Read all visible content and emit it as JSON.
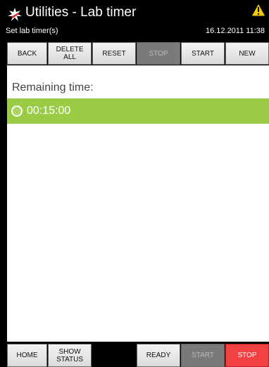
{
  "header": {
    "title": "Utilities - Lab timer",
    "subtitle": "Set lab timer(s)",
    "datetime": "16.12.2011 11:38",
    "logo_icon": "tool-logo-icon",
    "warning_icon": "warning-triangle-icon"
  },
  "toolbar": [
    {
      "label": "BACK",
      "state": "enabled"
    },
    {
      "label": "DELETE\nALL",
      "state": "enabled"
    },
    {
      "label": "RESET",
      "state": "enabled"
    },
    {
      "label": "STOP",
      "state": "disabled"
    },
    {
      "label": "START",
      "state": "enabled"
    },
    {
      "label": "NEW",
      "state": "enabled"
    }
  ],
  "main": {
    "remaining_label": "Remaining time:",
    "timers": [
      {
        "value": "00:15:00",
        "selected": false,
        "color": "#99cc44"
      }
    ]
  },
  "bottombar": [
    {
      "label": "HOME",
      "state": "enabled"
    },
    {
      "label": "SHOW\nSTATUS",
      "state": "enabled"
    },
    {
      "label": "",
      "state": "blank"
    },
    {
      "label": "READY",
      "state": "enabled"
    },
    {
      "label": "START",
      "state": "disabled"
    },
    {
      "label": "STOP",
      "state": "danger"
    }
  ],
  "colors": {
    "accent_green": "#99cc44",
    "stop_red": "#f34040",
    "disabled_gray": "#7a7a7a"
  }
}
